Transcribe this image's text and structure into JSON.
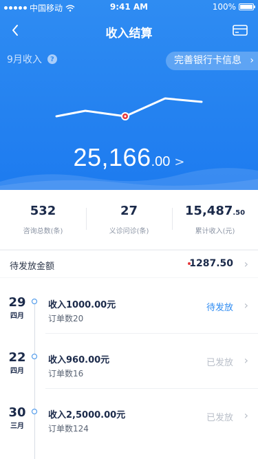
{
  "status_bar": {
    "carrier": "中国移动",
    "time": "9:41 AM",
    "battery": "100%"
  },
  "nav": {
    "title": "收入结算"
  },
  "hero": {
    "month_label": "9月收入",
    "help": "?",
    "bank_button": "完善银行卡信息",
    "total_int": "25,166",
    "total_dec": ".00",
    "total_arrow": ">"
  },
  "stats": [
    {
      "value": "532",
      "value_dec": "",
      "label": "咨询总数(条)"
    },
    {
      "value": "27",
      "value_dec": "",
      "label": "义诊问诊(条)"
    },
    {
      "value": "15,487",
      "value_dec": ".50",
      "label": "累计收入(元)"
    }
  ],
  "pending": {
    "label": "待发放金额",
    "value": "1287.50"
  },
  "records": [
    {
      "day": "29",
      "month": "四月",
      "income": "收入1000.00元",
      "orders": "订单数20",
      "status": "待发放"
    },
    {
      "day": "22",
      "month": "四月",
      "income": "收入960.00元",
      "orders": "订单数16",
      "status": "已发放"
    },
    {
      "day": "30",
      "month": "三月",
      "income": "收入2,5000.00元",
      "orders": "订单数124",
      "status": "已发放"
    }
  ],
  "colors": {
    "primary": "#2f8cf2",
    "marker": "#e5383b",
    "muted": "#b8bec8"
  }
}
